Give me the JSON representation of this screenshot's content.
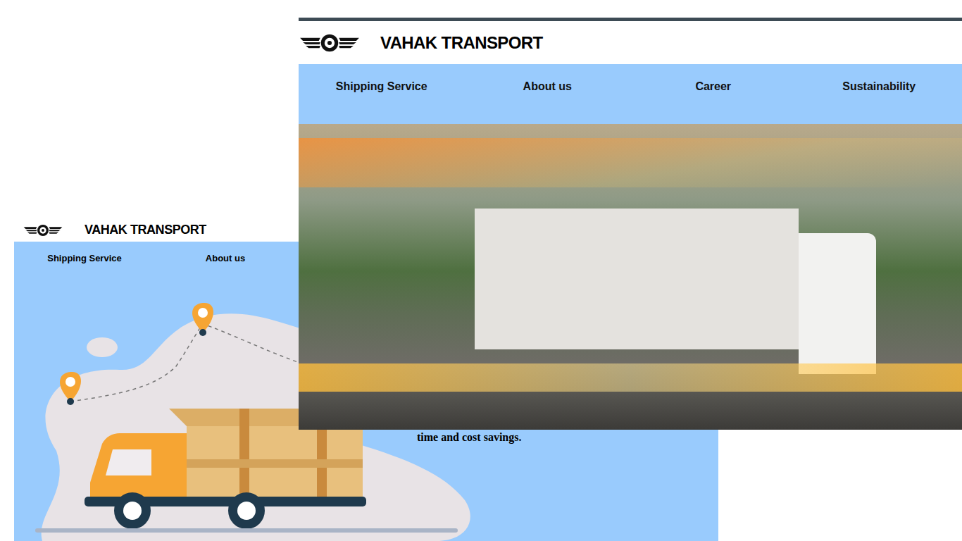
{
  "back_page": {
    "brand": "VAHAK TRANSPORT",
    "nav": [
      "Shipping Service",
      "About us"
    ],
    "text": "time and cost savings."
  },
  "front_page": {
    "brand": "VAHAK TRANSPORT",
    "nav": [
      "Shipping Service",
      "About us",
      "Career",
      "Sustainability"
    ]
  }
}
